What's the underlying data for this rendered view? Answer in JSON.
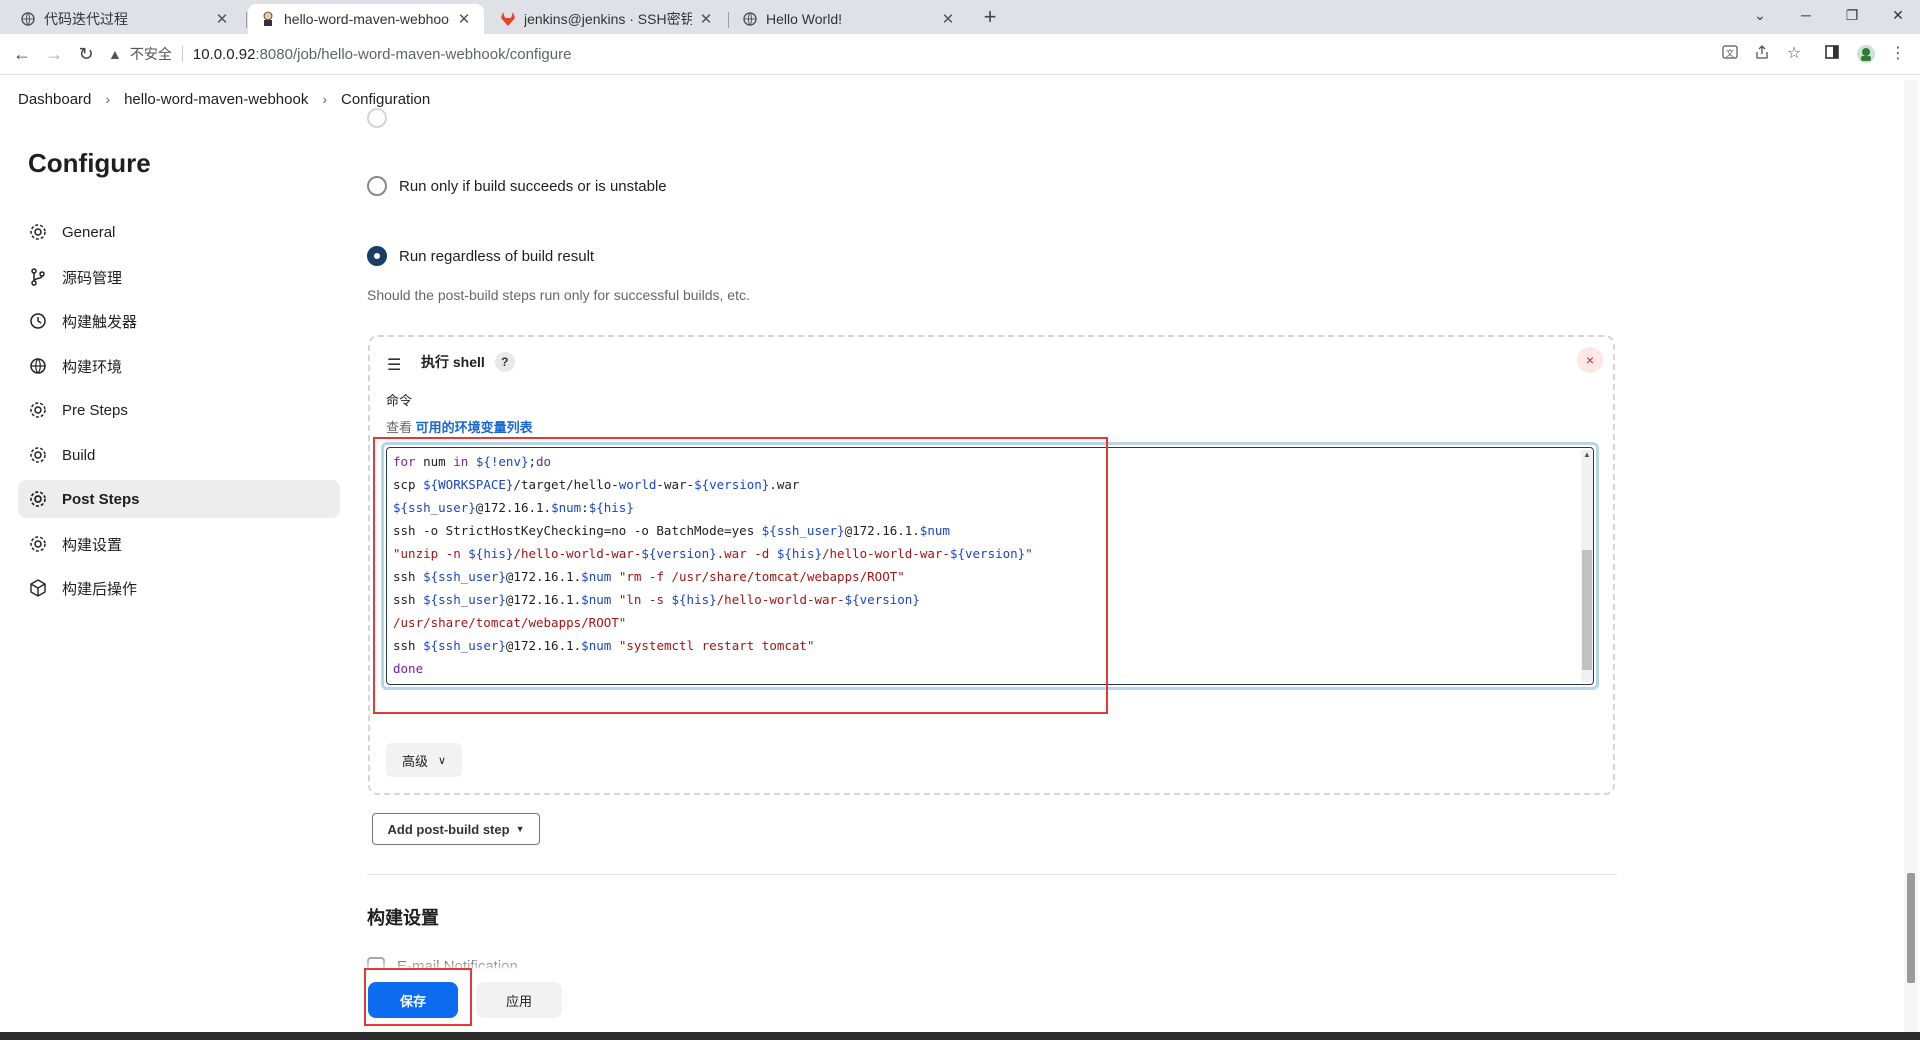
{
  "tabs": [
    {
      "title": "代码迭代过程",
      "active": false
    },
    {
      "title": "hello-word-maven-webhook C",
      "active": true
    },
    {
      "title": "jenkins@jenkins · SSH密钥 · 用",
      "active": false
    },
    {
      "title": "Hello World!",
      "active": false
    }
  ],
  "address": {
    "insecure_label": "不安全",
    "host": "10.0.0.92",
    "path": ":8080/job/hello-word-maven-webhook/configure"
  },
  "breadcrumb": {
    "items": [
      "Dashboard",
      "hello-word-maven-webhook",
      "Configuration"
    ]
  },
  "sidebar": {
    "title": "Configure",
    "items": [
      {
        "label": "General",
        "icon": "gear-icon"
      },
      {
        "label": "源码管理",
        "icon": "branch-icon"
      },
      {
        "label": "构建触发器",
        "icon": "clock-icon"
      },
      {
        "label": "构建环境",
        "icon": "globe-icon"
      },
      {
        "label": "Pre Steps",
        "icon": "gear-icon"
      },
      {
        "label": "Build",
        "icon": "gear-icon"
      },
      {
        "label": "Post Steps",
        "icon": "gear-icon",
        "active": true
      },
      {
        "label": "构建设置",
        "icon": "gear-icon"
      },
      {
        "label": "构建后操作",
        "icon": "package-icon"
      }
    ]
  },
  "post_steps": {
    "radio_success_unstable": "Run only if build succeeds or is unstable",
    "radio_regardless": "Run regardless of build result",
    "selected": "Run regardless of build result",
    "description": "Should the post-build steps run only for successful builds, etc.",
    "step_title": "执行 shell",
    "help_mark": "?",
    "delete_symbol": "×",
    "command_label": "命令",
    "env_prefix": "查看",
    "env_link": "可用的环境变量列表",
    "advanced_label": "高级",
    "add_step_label": "Add post-build step"
  },
  "build_settings": {
    "title": "构建设置",
    "email_label": "E-mail Notification"
  },
  "footer": {
    "save_label": "保存",
    "apply_label": "应用"
  },
  "colors": {
    "accent": "#0b6cf0",
    "highlight_box": "#e53935",
    "active_radio": "#1a3f66"
  }
}
